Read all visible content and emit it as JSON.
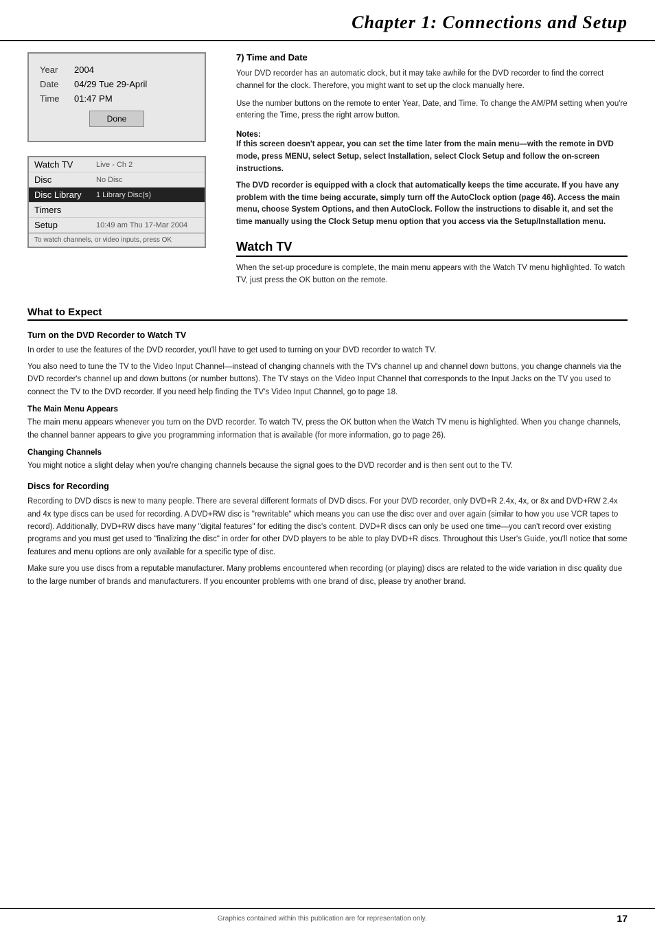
{
  "header": {
    "title": "Chapter 1: Connections and Setup"
  },
  "clock_screen": {
    "rows": [
      {
        "label": "Year",
        "value": "2004"
      },
      {
        "label": "Date",
        "value": "04/29 Tue 29-April"
      },
      {
        "label": "Time",
        "value": "01:47 PM"
      }
    ],
    "done_label": "Done"
  },
  "menu_screen": {
    "items": [
      {
        "label": "Watch TV",
        "value": "Live - Ch 2",
        "selected": false
      },
      {
        "label": "Disc",
        "value": "No Disc",
        "selected": false
      },
      {
        "label": "Disc Library",
        "value": "1 Library Disc(s)",
        "selected": true
      },
      {
        "label": "Timers",
        "value": "",
        "selected": false
      },
      {
        "label": "Setup",
        "value": "10:49 am Thu 17-Mar 2004",
        "selected": false
      }
    ],
    "footer": "To watch channels, or video inputs, press OK"
  },
  "section7": {
    "heading": "7) Time and Date",
    "para1": "Your DVD recorder has an automatic clock, but it may take awhile for the DVD recorder to find the correct channel for the clock. Therefore, you might want to set up the clock manually here.",
    "para2": "Use the number buttons on the remote to enter Year, Date, and Time. To change the AM/PM setting when you're entering the Time, press the right arrow button.",
    "notes_label": "Notes:",
    "note1": "If this screen doesn't appear, you can set the time later from the main menu—with the remote in DVD mode, press MENU, select Setup, select Installation, select Clock Setup and follow the on-screen instructions.",
    "note2": "The DVD recorder is equipped with a clock that automatically keeps the time accurate. If you have any problem with the time being accurate, simply turn off the AutoClock option (page 46). Access the main menu, choose System Options, and then AutoClock. Follow the instructions to disable it, and set the time manually using the Clock Setup menu option that you access via the Setup/Installation menu."
  },
  "watch_tv_section": {
    "heading": "Watch TV",
    "body": "When the set-up procedure is complete, the main menu appears with the Watch TV menu highlighted. To watch TV, just press the OK button on the remote."
  },
  "what_to_expect": {
    "heading": "What to Expect",
    "sub1": {
      "heading": "Turn on the DVD Recorder to Watch TV",
      "para1": "In order to use the features of the DVD recorder, you'll have to get used to turning on your DVD recorder to watch TV.",
      "para2": "You also need to tune the TV to the Video Input Channel—instead of changing channels with the TV's channel up and channel down buttons, you change channels via the DVD recorder's channel up and down buttons (or number buttons). The TV stays on the Video Input Channel that corresponds to the Input Jacks on the TV you used to connect the TV to the DVD recorder. If you need help finding the TV's Video Input Channel, go to page 18.",
      "sub1a": {
        "heading": "The Main Menu Appears",
        "body": "The main menu appears whenever you turn on the DVD recorder. To watch TV, press the OK button when the Watch TV menu is highlighted. When you change channels, the channel banner appears to give you programming information that is available (for more information, go to page 26)."
      },
      "sub1b": {
        "heading": "Changing Channels",
        "body": "You might notice a slight delay when you're changing channels because the signal goes to the DVD recorder and is then sent out to the TV."
      }
    },
    "sub2": {
      "heading": "Discs for Recording",
      "para1": "Recording to DVD discs is new to many people. There are several different formats of DVD discs. For your DVD recorder, only DVD+R 2.4x, 4x, or 8x and DVD+RW 2.4x and 4x type discs can be used for recording. A DVD+RW disc is \"rewritable\" which means you can use the disc over and over again (similar to how you use VCR tapes to record). Additionally, DVD+RW discs have many \"digital features\" for editing the disc's content. DVD+R discs can only be used one time—you can't record over existing programs and you must get used to \"finalizing the disc\" in order for other DVD players to be able to play DVD+R discs. Throughout this User's Guide, you'll notice that some features and menu options are only available for a specific type of disc.",
      "para2": "Make sure you use discs from a reputable manufacturer. Many problems encountered when recording (or playing) discs are related to the wide variation in disc quality due to the large number of brands and manufacturers. If you encounter problems with one brand of disc, please try another brand."
    }
  },
  "footer": {
    "center_text": "Graphics contained within this publication are for representation only.",
    "page_number": "17"
  }
}
